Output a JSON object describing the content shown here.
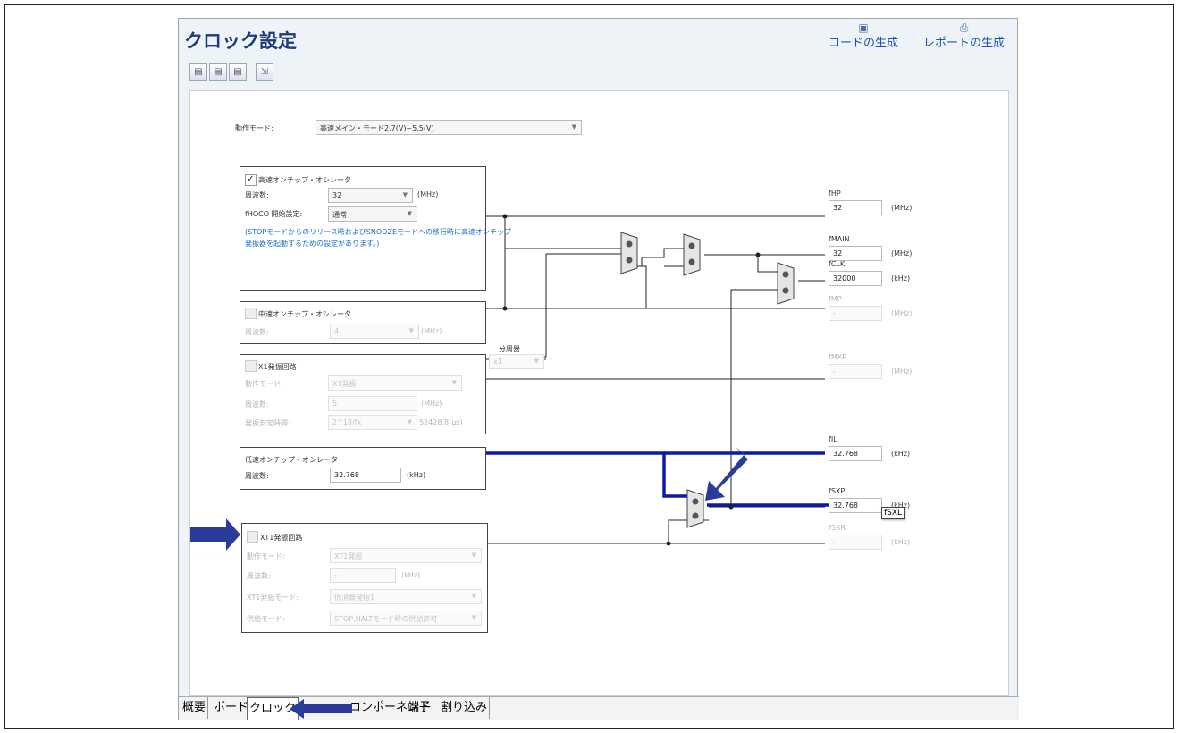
{
  "app": {
    "title": "クロック設定",
    "code_gen_label": "コードの生成",
    "report_gen_label": "レポートの生成",
    "toolbar_icons": [
      "page-icon",
      "page-icon",
      "page-icon",
      "page-export-icon"
    ]
  },
  "mode": {
    "label": "動作モード:",
    "value": "高速メイン・モード2.7(V)~5.5(V)"
  },
  "hoco": {
    "title": "高速オンチップ・オシレータ",
    "checked": true,
    "freq_label": "周波数:",
    "freq_value": "32",
    "freq_unit": "(MHz)",
    "start_label": "fHOCO 開始設定:",
    "start_value": "通常",
    "note_line1": "(STOPモードからのリリース時およびSNOOZEモードへの移行時に高速オンチップ",
    "note_line2": "発振器を起動するための設定があります。)"
  },
  "moco": {
    "title": "中速オンチップ・オシレータ",
    "freq_label": "周波数:",
    "freq_value": "4",
    "freq_unit": "(MHz)"
  },
  "divider": {
    "label": "分周器",
    "value": "x1"
  },
  "x1": {
    "title": "X1発振回路",
    "mode_label": "動作モード:",
    "mode_value": "X1発振",
    "freq_label": "周波数:",
    "freq_value": "5",
    "freq_unit": "(MHz)",
    "stab_label": "発振安定時間:",
    "stab_value": "2^18/fx",
    "stab_result": "52428.8(μs)"
  },
  "loco": {
    "title": "低速オンチップ・オシレータ",
    "freq_label": "周波数:",
    "freq_value": "32.768",
    "freq_unit": "(kHz)"
  },
  "xt1": {
    "title": "XT1発振回路",
    "mode_label": "動作モード:",
    "mode_value": "XT1発振",
    "freq_label": "周波数:",
    "freq_value": "-",
    "freq_unit": "(kHz)",
    "osc_mode_label": "XT1発振モード:",
    "osc_mode_value": "低消費発振1",
    "supply_label": "供給モード:",
    "supply_value": "STOP,HALTモード時の供給許可"
  },
  "outputs": [
    {
      "name": "fHP",
      "value": "32",
      "unit": "(MHz)",
      "enabled": true
    },
    {
      "name": "fMAIN",
      "value": "32",
      "unit": "(MHz)",
      "enabled": true
    },
    {
      "name": "fCLK",
      "value": "32000",
      "unit": "(kHz)",
      "enabled": true
    },
    {
      "name": "fMP",
      "value": "-",
      "unit": "(MHz)",
      "enabled": false
    },
    {
      "name": "fMXP",
      "value": "-",
      "unit": "(MHz)",
      "enabled": false
    },
    {
      "name": "fIL",
      "value": "32.768",
      "unit": "(kHz)",
      "enabled": true
    },
    {
      "name": "fSXP",
      "value": "32.768",
      "unit": "(kHz)",
      "enabled": true
    },
    {
      "name": "fSXR",
      "value": "-",
      "unit": "(kHz)",
      "enabled": false
    }
  ],
  "tooltip": "fSXL",
  "tabs": [
    "概要",
    "ボード",
    "クロック",
    "コンポーネント",
    "端子",
    "割り込み"
  ],
  "active_tab": "クロック",
  "colors": {
    "accent": "#1e3a78",
    "highlight_wire": "#0a1aa8",
    "arrow": "#2a3b9a",
    "link_text": "#1e55b0"
  }
}
